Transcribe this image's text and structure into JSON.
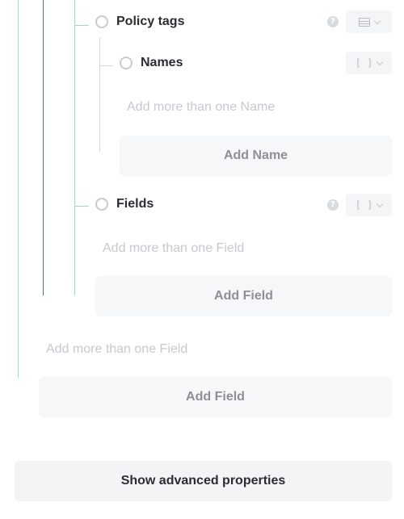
{
  "properties": {
    "policy_tags": {
      "name": "Policy tags",
      "type_icon": "table-grid-icon",
      "help_icon": "?"
    },
    "names": {
      "name": "Names",
      "type_label": "[ ]",
      "hint": "Add more than one Name",
      "add_label": "Add Name"
    },
    "fields_inner": {
      "name": "Fields",
      "type_label": "[ ]",
      "help_icon": "?",
      "hint": "Add more than one Field",
      "add_label": "Add Field"
    },
    "fields_outer": {
      "hint": "Add more than one Field",
      "add_label": "Add Field"
    }
  },
  "footer": {
    "advanced_label": "Show advanced properties"
  },
  "colors": {
    "guide_cyan": "#9bd6dc",
    "guide_blue": "#4f6fc4",
    "guide_grey": "#d4d7dc"
  }
}
